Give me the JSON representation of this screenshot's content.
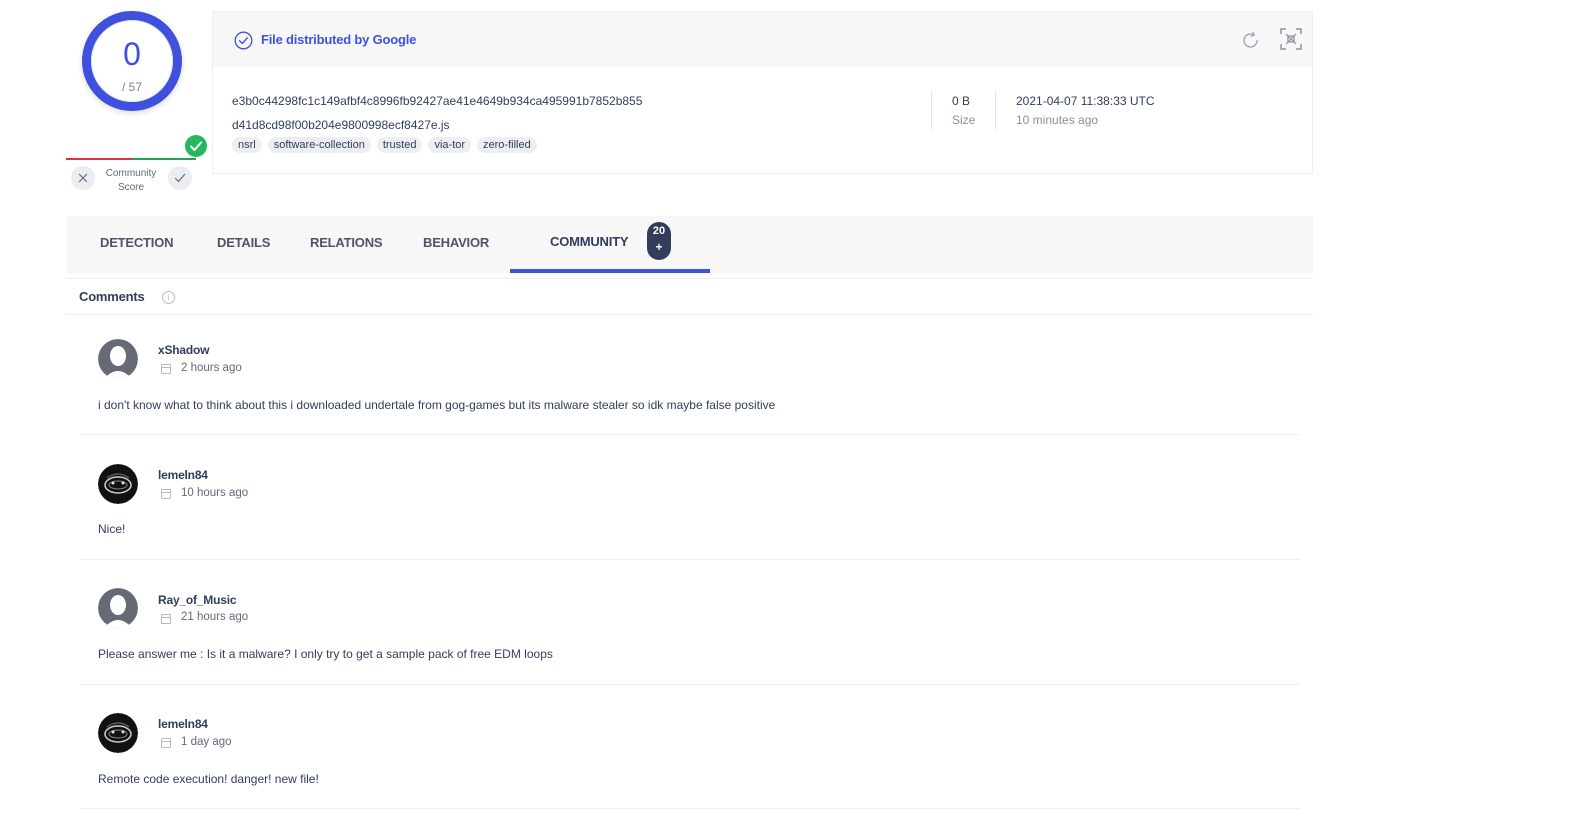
{
  "score": {
    "detected": "0",
    "total": "/ 57"
  },
  "community_score": {
    "label_line1": "Community",
    "label_line2": "Score"
  },
  "file": {
    "distributed_by": "File distributed by Google",
    "hash": "e3b0c44298fc1c149afbf4c8996fb92427ae41e4649b934ca495991b7852b855",
    "name": "d41d8cd98f00b204e9800998ecf8427e.js",
    "tags": [
      "nsrl",
      "software-collection",
      "trusted",
      "via-tor",
      "zero-filled"
    ],
    "size_value": "0 B",
    "size_label": "Size",
    "date_value": "2021-04-07 11:38:33 UTC",
    "date_label": "10 minutes ago"
  },
  "tabs": [
    {
      "label": "DETECTION"
    },
    {
      "label": "DETAILS"
    },
    {
      "label": "RELATIONS"
    },
    {
      "label": "BEHAVIOR"
    },
    {
      "label": "COMMUNITY",
      "badge": "20",
      "badge_plus": "+"
    }
  ],
  "comments_section": {
    "title": "Comments",
    "info": "i"
  },
  "comments": [
    {
      "author": "xShadow",
      "time": "2 hours ago",
      "text": "i don't know what to think about this i downloaded undertale from gog-games but its malware stealer so idk maybe false positive",
      "avatar": "default"
    },
    {
      "author": "lemeln84",
      "time": "10 hours ago",
      "text": "Nice!",
      "avatar": "dark"
    },
    {
      "author": "Ray_of_Music",
      "time": "21 hours ago",
      "text": "Please answer me : Is it a malware? I only try to get a sample pack of free EDM loops",
      "avatar": "default"
    },
    {
      "author": "lemeln84",
      "time": "1 day ago",
      "text": "Remote code execution! danger! new file!",
      "avatar": "dark"
    }
  ],
  "colors": {
    "accent": "#3f51dc",
    "text": "#313d5a",
    "green": "#25b860",
    "red": "#e0303f"
  },
  "icons": [
    "check-circle-icon",
    "refresh-icon",
    "fullscreen-icon",
    "close-icon",
    "check-icon",
    "info-icon",
    "calendar-icon"
  ]
}
